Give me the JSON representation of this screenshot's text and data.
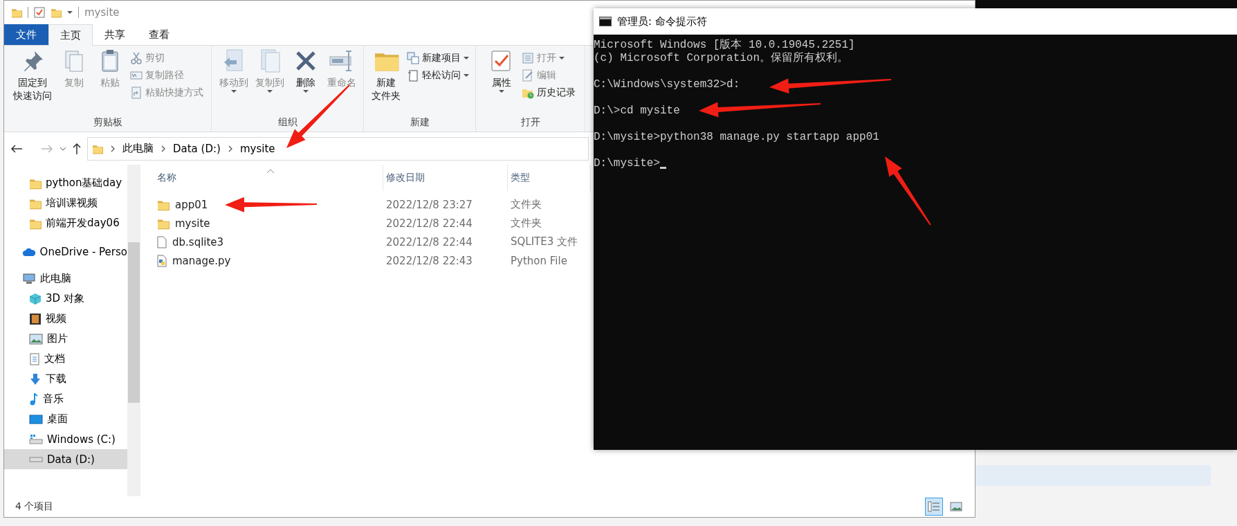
{
  "explorer": {
    "title": "mysite",
    "tabs": [
      {
        "label": "文件",
        "kind": "file",
        "selected": false
      },
      {
        "label": "主页",
        "kind": "tab",
        "selected": true
      },
      {
        "label": "共享",
        "kind": "tab",
        "selected": false
      },
      {
        "label": "查看",
        "kind": "tab",
        "selected": false
      }
    ],
    "ribbon": [
      {
        "label": "剪贴板",
        "buttons": [
          {
            "kind": "large",
            "label": "固定到快速访问",
            "disabled": false,
            "dropdown": false
          },
          {
            "kind": "large",
            "label": "复制",
            "disabled": true,
            "dropdown": false
          },
          {
            "kind": "large",
            "label": "粘贴",
            "disabled": true,
            "dropdown": false
          },
          {
            "kind": "stack",
            "items": [
              {
                "label": "剪切",
                "disabled": true,
                "dropdown": false
              },
              {
                "label": "复制路径",
                "disabled": true,
                "dropdown": false
              },
              {
                "label": "粘贴快捷方式",
                "disabled": true,
                "dropdown": false
              }
            ]
          }
        ]
      },
      {
        "label": "组织",
        "buttons": [
          {
            "kind": "large",
            "label": "移动到",
            "disabled": true,
            "dropdown": true
          },
          {
            "kind": "large",
            "label": "复制到",
            "disabled": true,
            "dropdown": true
          },
          {
            "kind": "large",
            "label": "删除",
            "disabled": false,
            "dropdown": true
          },
          {
            "kind": "large",
            "label": "重命名",
            "disabled": true,
            "dropdown": false
          }
        ]
      },
      {
        "label": "新建",
        "buttons": [
          {
            "kind": "large",
            "label": "新建文件夹",
            "disabled": false,
            "dropdown": false
          },
          {
            "kind": "stack",
            "items": [
              {
                "label": "新建项目",
                "disabled": false,
                "dropdown": true
              },
              {
                "label": "轻松访问",
                "disabled": false,
                "dropdown": true
              }
            ]
          }
        ]
      },
      {
        "label": "打开",
        "buttons": [
          {
            "kind": "large",
            "label": "属性",
            "disabled": false,
            "dropdown": true
          },
          {
            "kind": "stack",
            "items": [
              {
                "label": "打开",
                "disabled": true,
                "dropdown": true
              },
              {
                "label": "编辑",
                "disabled": true,
                "dropdown": false
              },
              {
                "label": "历史记录",
                "disabled": false,
                "dropdown": false
              }
            ]
          }
        ]
      }
    ],
    "breadcrumb": [
      "此电脑",
      "Data (D:)",
      "mysite"
    ],
    "sidebar": {
      "quick_access": [
        {
          "label": "python基础day",
          "kind": "folder",
          "selected": false
        },
        {
          "label": "培训课视频",
          "kind": "folder",
          "selected": false
        },
        {
          "label": "前端开发day06",
          "kind": "folder",
          "selected": false
        }
      ],
      "items": [
        {
          "label": "OneDrive - Perso",
          "kind": "cloud",
          "selected": false
        },
        {
          "label": "此电脑",
          "kind": "computer",
          "selected": false,
          "children": [
            {
              "label": "3D 对象",
              "kind": "cube",
              "selected": false
            },
            {
              "label": "视频",
              "kind": "film",
              "selected": false
            },
            {
              "label": "图片",
              "kind": "image",
              "selected": false
            },
            {
              "label": "文档",
              "kind": "document",
              "selected": false
            },
            {
              "label": "下载",
              "kind": "download",
              "selected": false
            },
            {
              "label": "音乐",
              "kind": "music",
              "selected": false
            },
            {
              "label": "桌面",
              "kind": "desktop",
              "selected": false
            },
            {
              "label": "Windows (C:)",
              "kind": "windrive",
              "selected": false
            },
            {
              "label": "Data (D:)",
              "kind": "drive",
              "selected": true
            }
          ]
        }
      ]
    },
    "columns": [
      "名称",
      "修改日期",
      "类型"
    ],
    "files": [
      {
        "name": "app01",
        "kind": "folder",
        "modified": "2022/12/8 23:27",
        "type": "文件夹"
      },
      {
        "name": "mysite",
        "kind": "folder",
        "modified": "2022/12/8 22:44",
        "type": "文件夹"
      },
      {
        "name": "db.sqlite3",
        "kind": "file",
        "modified": "2022/12/8 22:44",
        "type": "SQLITE3 文件"
      },
      {
        "name": "manage.py",
        "kind": "python",
        "modified": "2022/12/8 22:43",
        "type": "Python File"
      }
    ],
    "status": "4 个项目",
    "view_buttons": [
      {
        "kind": "details",
        "selected": true
      },
      {
        "kind": "thumbnails",
        "selected": false
      }
    ]
  },
  "cmd": {
    "title": "管理员: 命令提示符",
    "blocks": [
      [
        "Microsoft Windows [版本 10.0.19045.2251]",
        "(c) Microsoft Corporation。保留所有权利。"
      ],
      [
        "C:\\Windows\\system32>d:"
      ],
      [
        "D:\\>cd mysite"
      ],
      [
        "D:\\mysite>python38 manage.py startapp app01"
      ],
      [
        "D:\\mysite>"
      ]
    ]
  }
}
